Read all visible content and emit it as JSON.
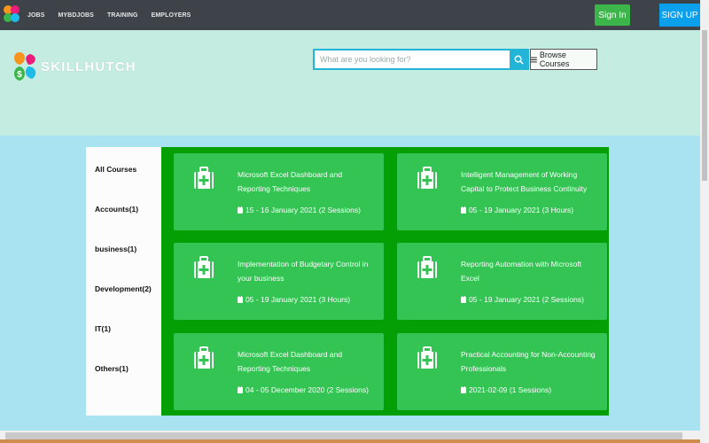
{
  "nav": {
    "links": [
      "JOBS",
      "MYBDJOBS",
      "TRAINING",
      "EMPLOYERS"
    ],
    "signin_label": "Sign In",
    "signup_label": "SIGN UP"
  },
  "brand": {
    "name": "SKILLHUTCH"
  },
  "search": {
    "placeholder": "What are you looking for?",
    "value": "",
    "browse_label": "Browse Courses"
  },
  "categories": [
    "All Courses",
    "Accounts(1)",
    "business(1)",
    "Development(2)",
    "IT(1)",
    "Others(1)"
  ],
  "courses": [
    {
      "title": "Microsoft Excel Dashboard and Reporting Techniques",
      "date": "15 - 16 January 2021 (2 Sessions)"
    },
    {
      "title": "Intelligent Management of Working Capital to Protect Business Continuity",
      "date": "05 - 19 January 2021 (3 Hours)"
    },
    {
      "title": "Implementation of Budgetary Control in your business",
      "date": "05 - 19 January 2021 (3 Hours)"
    },
    {
      "title": "Reporting Automation with Microsoft Excel",
      "date": "05 - 19 January 2021 (2 Sessions)"
    },
    {
      "title": "Microsoft Excel Dashboard and Reporting Techniques",
      "date": "04 - 05 December 2020 (2 Sessions)"
    },
    {
      "title": "Practical Accounting for Non-Accounting Professionals",
      "date": "2021-02-09 (1 Sessions)"
    }
  ],
  "colors": {
    "nav_bg": "#3d4349",
    "header_bg": "#c5ece0",
    "page_bg": "#a9e3f2",
    "panel_green": "#049f05",
    "card_green": "#33c453",
    "signin_green": "#3cb54a",
    "signup_blue": "#0aa0ec",
    "search_accent": "#22b5d8"
  }
}
